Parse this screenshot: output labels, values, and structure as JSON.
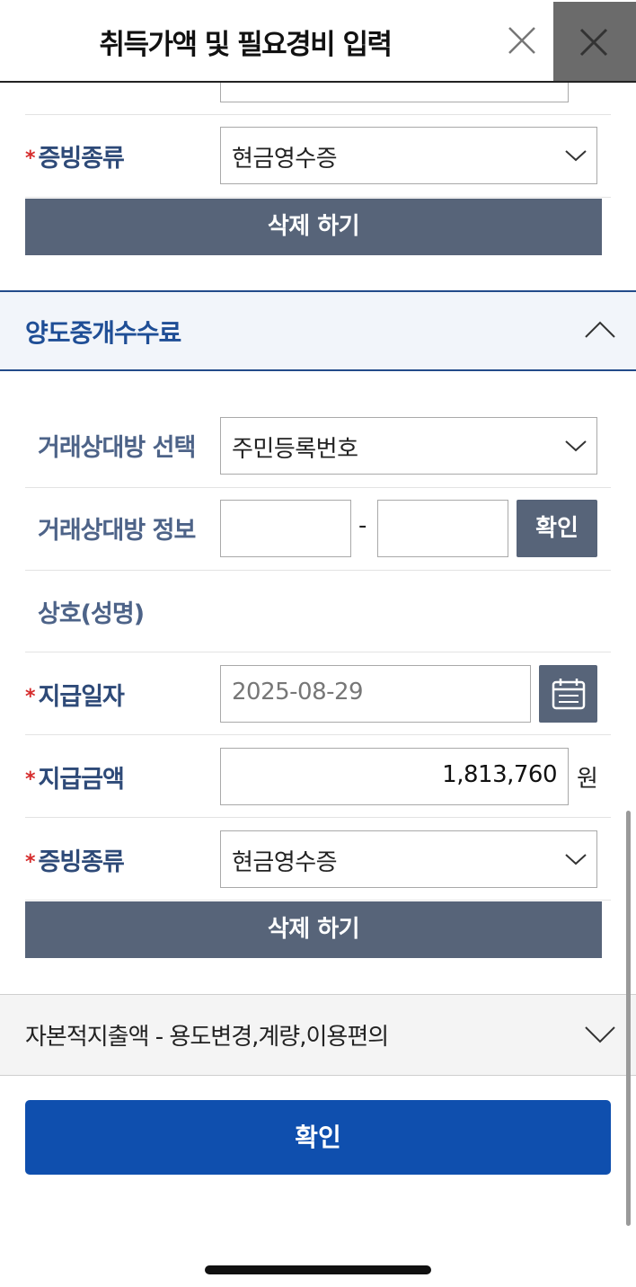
{
  "header": {
    "title": "취득가액 및 필요경비 입력"
  },
  "section1": {
    "evidence_label": "증빙종류",
    "evidence_value": "현금영수증",
    "delete_label": "삭제 하기"
  },
  "section2": {
    "title": "양도중개수수료",
    "counterparty_select_label": "거래상대방 선택",
    "counterparty_select_value": "주민등록번호",
    "counterparty_info_label": "거래상대방 정보",
    "id_part1": "",
    "id_separator": "-",
    "id_part2": "",
    "verify_label": "확인",
    "name_label": "상호(성명)",
    "pay_date_label": "지급일자",
    "pay_date_value": "2025-08-29",
    "pay_amount_label": "지급금액",
    "pay_amount_value": "1,813,760",
    "currency_unit": "원",
    "evidence_label": "증빙종류",
    "evidence_value": "현금영수증",
    "delete_label": "삭제 하기"
  },
  "section3": {
    "title": "자본적지출액 - 용도변경,계량,이용편의"
  },
  "footer": {
    "confirm_label": "확인"
  },
  "colors": {
    "primary": "#0f4fae",
    "slate": "#576479",
    "required": "#d62c2c",
    "label": "#2e4a78"
  }
}
